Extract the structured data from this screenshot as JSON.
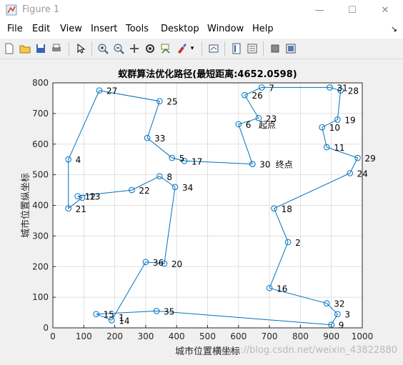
{
  "window": {
    "title": "Figure 1",
    "min": "—",
    "max": "☐",
    "close": "✕"
  },
  "menu": [
    "File",
    "Edit",
    "View",
    "Insert",
    "Tools",
    "Desktop",
    "Window",
    "Help"
  ],
  "menu_arrow": "↘",
  "toolbar": {
    "icons": [
      "new-figure-icon",
      "open-file-icon",
      "save-icon",
      "print-icon",
      "pointer-icon",
      "zoom-in-icon",
      "zoom-out-icon",
      "pan-icon",
      "rotate-3d-icon",
      "data-cursor-icon",
      "brush-icon",
      "brush-dropdown-icon",
      "link-plot-icon",
      "insert-colorbar-icon",
      "insert-legend-icon",
      "hide-plot-tools-icon",
      "show-plot-tools-icon"
    ]
  },
  "watermark": "https://blog.csdn.net/weixin_43822880",
  "chart_data": {
    "type": "line",
    "title": "蚁群算法优化路径(最短距离:4652.0598)",
    "xlabel": "城市位置横坐标",
    "ylabel": "城市位置纵坐标",
    "xlim": [
      0,
      1000
    ],
    "ylim": [
      0,
      800
    ],
    "xticks": [
      "0",
      "100",
      "200",
      "300",
      "400",
      "500",
      "600",
      "700",
      "800",
      "900",
      "1000"
    ],
    "yticks": [
      "0",
      "100",
      "200",
      "300",
      "400",
      "500",
      "600",
      "700",
      "800"
    ],
    "grid": true,
    "line_color": "#0072bd",
    "route": [
      [
        645,
        535
      ],
      [
        600,
        665
      ],
      [
        665,
        685
      ],
      [
        620,
        760
      ],
      [
        675,
        785
      ],
      [
        895,
        785
      ],
      [
        930,
        775
      ],
      [
        920,
        680
      ],
      [
        870,
        655
      ],
      [
        885,
        590
      ],
      [
        985,
        555
      ],
      [
        960,
        505
      ],
      [
        715,
        390
      ],
      [
        760,
        280
      ],
      [
        700,
        130
      ],
      [
        885,
        80
      ],
      [
        920,
        45
      ],
      [
        900,
        10
      ],
      [
        335,
        55
      ],
      [
        140,
        45
      ],
      [
        190,
        25
      ],
      [
        300,
        215
      ],
      [
        360,
        210
      ],
      [
        395,
        460
      ],
      [
        345,
        495
      ],
      [
        255,
        450
      ],
      [
        80,
        430
      ],
      [
        95,
        425
      ],
      [
        50,
        390
      ],
      [
        50,
        550
      ],
      [
        150,
        775
      ],
      [
        345,
        740
      ],
      [
        305,
        620
      ],
      [
        385,
        555
      ],
      [
        425,
        545
      ],
      [
        645,
        535
      ]
    ],
    "labels": [
      {
        "id": "1",
        "x": 190,
        "y": 35
      },
      {
        "id": "2",
        "x": 760,
        "y": 280
      },
      {
        "id": "3",
        "x": 920,
        "y": 45
      },
      {
        "id": "4",
        "x": 50,
        "y": 550
      },
      {
        "id": "5",
        "x": 385,
        "y": 555
      },
      {
        "id": "6",
        "x": 600,
        "y": 665
      },
      {
        "id": "7",
        "x": 675,
        "y": 785
      },
      {
        "id": "8",
        "x": 345,
        "y": 495
      },
      {
        "id": "9",
        "x": 900,
        "y": 10
      },
      {
        "id": "10",
        "x": 870,
        "y": 655
      },
      {
        "id": "11",
        "x": 885,
        "y": 590
      },
      {
        "id": "12",
        "x": 80,
        "y": 430
      },
      {
        "id": "13",
        "x": 95,
        "y": 430
      },
      {
        "id": "14",
        "x": 190,
        "y": 25
      },
      {
        "id": "15",
        "x": 140,
        "y": 45
      },
      {
        "id": "16",
        "x": 700,
        "y": 130
      },
      {
        "id": "17",
        "x": 425,
        "y": 545
      },
      {
        "id": "18",
        "x": 715,
        "y": 390
      },
      {
        "id": "19",
        "x": 920,
        "y": 680
      },
      {
        "id": "20",
        "x": 360,
        "y": 210
      },
      {
        "id": "21",
        "x": 50,
        "y": 390
      },
      {
        "id": "22",
        "x": 255,
        "y": 450
      },
      {
        "id": "23",
        "x": 665,
        "y": 685
      },
      {
        "id": "24",
        "x": 960,
        "y": 505
      },
      {
        "id": "25",
        "x": 345,
        "y": 740
      },
      {
        "id": "26",
        "x": 620,
        "y": 760
      },
      {
        "id": "27",
        "x": 150,
        "y": 775
      },
      {
        "id": "28",
        "x": 930,
        "y": 775
      },
      {
        "id": "29",
        "x": 985,
        "y": 555
      },
      {
        "id": "30",
        "x": 645,
        "y": 535
      },
      {
        "id": "31",
        "x": 895,
        "y": 785
      },
      {
        "id": "32",
        "x": 885,
        "y": 80
      },
      {
        "id": "33",
        "x": 305,
        "y": 620
      },
      {
        "id": "34",
        "x": 395,
        "y": 460
      },
      {
        "id": "35",
        "x": 335,
        "y": 55
      },
      {
        "id": "36",
        "x": 300,
        "y": 215
      }
    ],
    "annotations": [
      {
        "text": "起点",
        "x": 665,
        "y": 665
      },
      {
        "text": "终点",
        "x": 720,
        "y": 535
      }
    ]
  }
}
